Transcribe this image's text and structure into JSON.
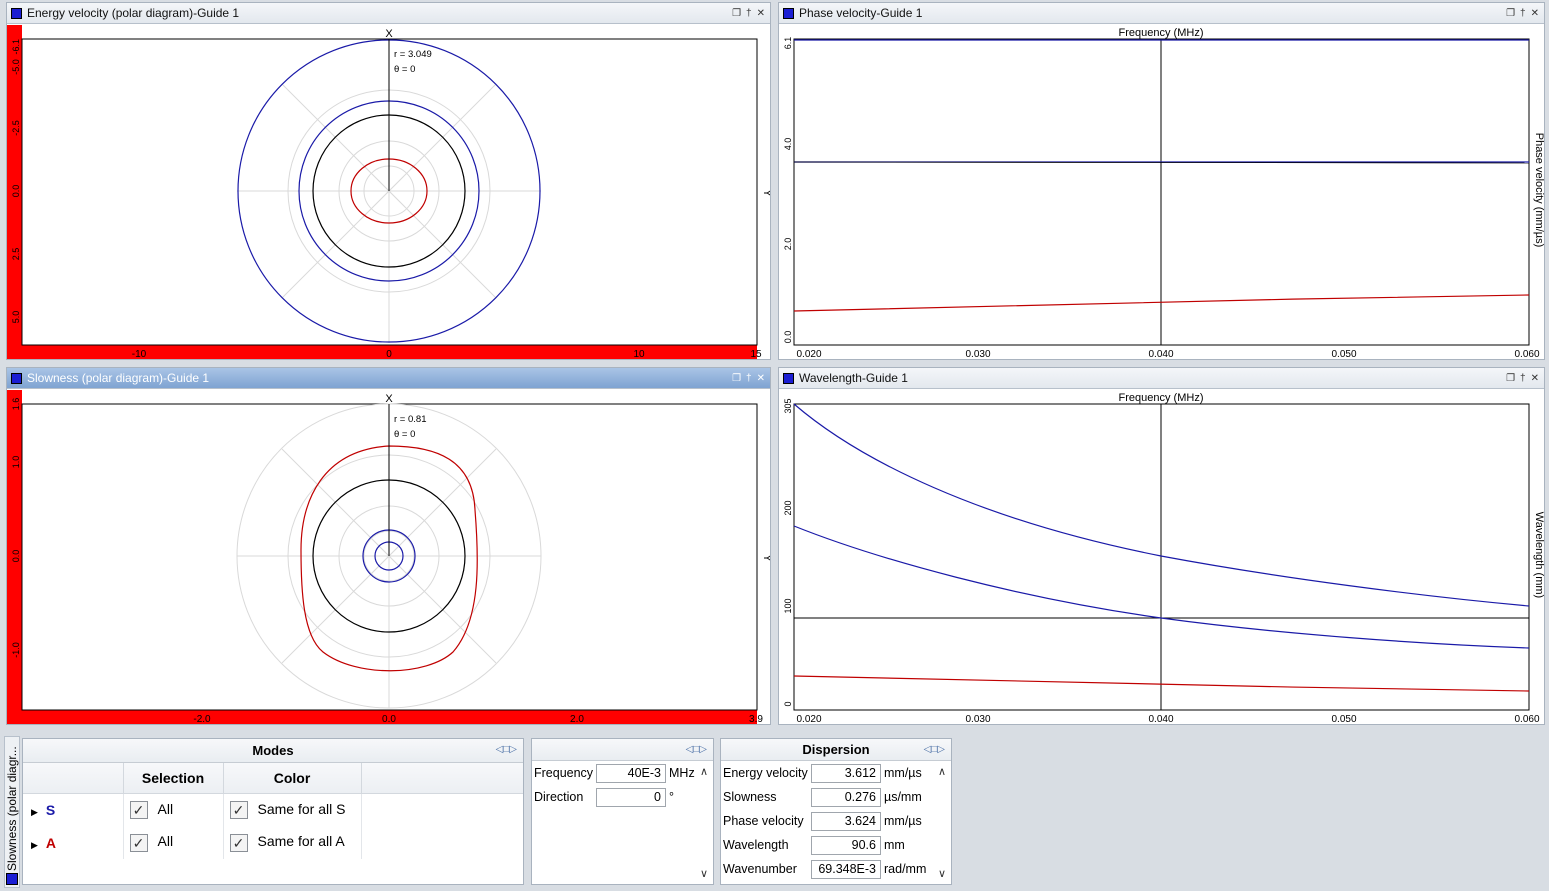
{
  "panels": {
    "energy": {
      "title": "Energy velocity (polar diagram)-Guide 1",
      "axis_x": "X",
      "axis_y": "Y",
      "r_label": "r = 3.049",
      "theta_label": "θ = 0",
      "xticks": [
        "-10",
        "0",
        "10",
        "15"
      ],
      "yticks": [
        "-6.1",
        "-5.0",
        "-2.5",
        "0.0",
        "2.5",
        "5.0"
      ]
    },
    "phase": {
      "title": "Phase velocity-Guide 1",
      "xlabel": "Frequency (MHz)",
      "ylabel": "Phase velocity (mm/µs)",
      "xticks": [
        "0.020",
        "0.030",
        "0.040",
        "0.050",
        "0.060"
      ],
      "yticks": [
        "6.1",
        "4.0",
        "2.0",
        "0.0"
      ]
    },
    "slowness": {
      "title": "Slowness (polar diagram)-Guide 1",
      "axis_x": "X",
      "axis_y": "Y",
      "r_label": "r = 0.81",
      "theta_label": "θ = 0",
      "xticks": [
        "-2.0",
        "0.0",
        "2.0",
        "3.9"
      ],
      "yticks": [
        "1.6",
        "1.0",
        "0.0",
        "-1.0"
      ]
    },
    "wavelength": {
      "title": "Wavelength-Guide 1",
      "xlabel": "Frequency (MHz)",
      "ylabel": "Wavelength (mm)",
      "xticks": [
        "0.020",
        "0.030",
        "0.040",
        "0.050",
        "0.060"
      ],
      "yticks": [
        "305",
        "200",
        "100",
        "0"
      ]
    }
  },
  "modes": {
    "title": "Modes",
    "col_selection": "Selection",
    "col_color": "Color",
    "rows": [
      {
        "name": "S",
        "selection": "All",
        "color": "Same for all S",
        "name_color": "#1a1aa8"
      },
      {
        "name": "A",
        "selection": "All",
        "color": "Same for all A",
        "name_color": "#c00000"
      }
    ]
  },
  "inputs": {
    "frequency": {
      "label": "Frequency",
      "value": "40E-3",
      "unit": "MHz"
    },
    "direction": {
      "label": "Direction",
      "value": "0",
      "unit": "°"
    }
  },
  "dispersion": {
    "title": "Dispersion",
    "rows": [
      {
        "label": "Energy velocity",
        "value": "3.612",
        "unit": "mm/µs"
      },
      {
        "label": "Slowness",
        "value": "0.276",
        "unit": "µs/mm"
      },
      {
        "label": "Phase velocity",
        "value": "3.624",
        "unit": "mm/µs"
      },
      {
        "label": "Wavelength",
        "value": "90.6",
        "unit": "mm"
      },
      {
        "label": "Wavenumber",
        "value": "69.348E-3",
        "unit": "rad/mm"
      }
    ]
  },
  "side_tab": "Slowness (polar diagr...",
  "colors": {
    "s_mode": "#1a1aa8",
    "a_mode": "#c00000",
    "cursor": "#000000",
    "axis_band": "#ff0000"
  },
  "icons": [
    "restore-icon",
    "pin-icon",
    "close-icon",
    "pin-panel-icon",
    "chevron-up-icon",
    "chevron-down-icon",
    "expand-arrow-icon"
  ]
}
